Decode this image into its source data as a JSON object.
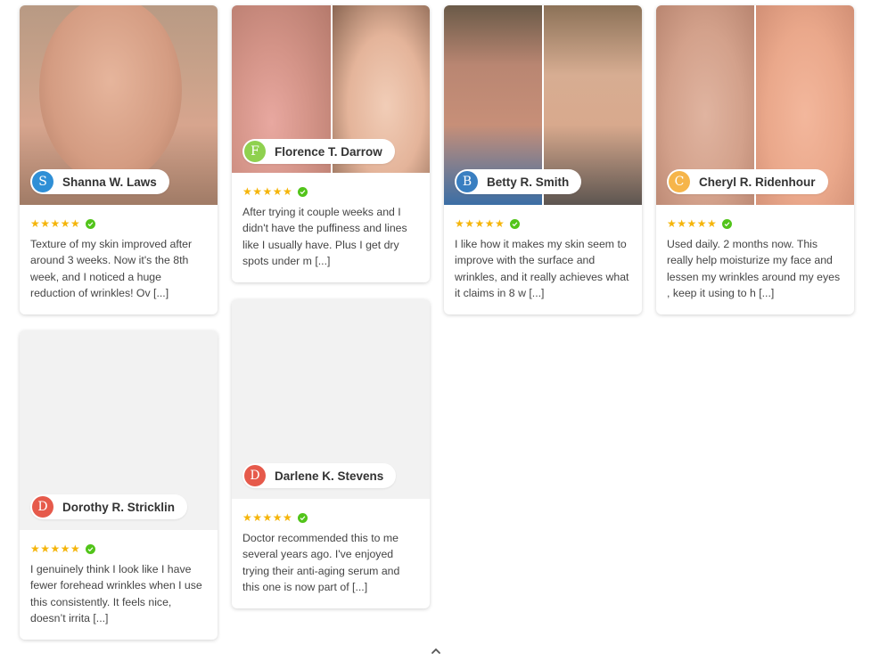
{
  "colors": {
    "star": "#f5b50a",
    "verified": "#52c41a"
  },
  "reviews": [
    {
      "name": "Shanna W. Laws",
      "initial": "S",
      "avatar_color": "#2f8fd6",
      "stars": "★★★★★",
      "text": "Texture of my skin improved after around 3 weeks. Now it's the 8th week, and I noticed a huge reduction of wrinkles! Ov [...]"
    },
    {
      "name": "Florence T. Darrow",
      "initial": "F",
      "avatar_color": "#8fd14f",
      "stars": "★★★★★",
      "text": "After trying it couple weeks and I didn't have the puffiness and lines like I usually have. Plus I get dry spots under m [...]"
    },
    {
      "name": "Betty R. Smith",
      "initial": "B",
      "avatar_color": "#3a7fc1",
      "stars": "★★★★★",
      "text": "I like how it makes my skin seem to improve with the surface and wrinkles, and it really achieves what it claims in 8 w [...]"
    },
    {
      "name": "Cheryl R. Ridenhour",
      "initial": "C",
      "avatar_color": "#f6b54a",
      "stars": "★★★★★",
      "text": "Used daily. 2 months now. This really help moisturize my face and lessen my wrinkles around my eyes , keep it using to h [...]"
    },
    {
      "name": "Dorothy R. Stricklin",
      "initial": "D",
      "avatar_color": "#e65a4b",
      "stars": "★★★★★",
      "text": "I genuinely think I look like I have fewer forehead wrinkles when I use this consistently. It feels nice, doesn’t irrita [...]"
    },
    {
      "name": "Darlene K. Stevens",
      "initial": "D",
      "avatar_color": "#e65a4b",
      "stars": "★★★★★",
      "text": "Doctor recommended this to me several years ago. I've enjoyed trying their anti-aging serum and this one is now part of [...]"
    }
  ]
}
